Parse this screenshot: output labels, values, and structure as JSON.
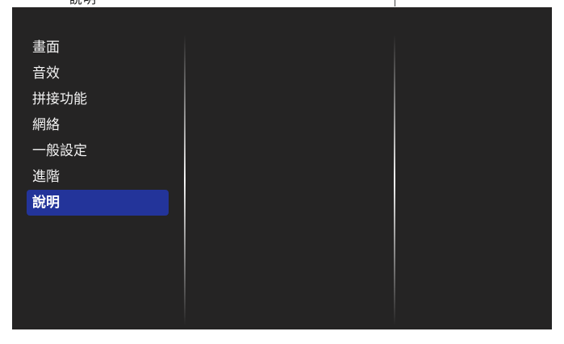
{
  "top_fragment": "說明",
  "menu": {
    "items": [
      {
        "label": "畫面"
      },
      {
        "label": "音效"
      },
      {
        "label": "拼接功能"
      },
      {
        "label": "網絡"
      },
      {
        "label": "一般設定"
      },
      {
        "label": "進階"
      },
      {
        "label": "說明"
      }
    ],
    "selected_index": 6
  },
  "colors": {
    "panel_background": "#252424",
    "selected_highlight": "#23349a",
    "menu_text": "#f2f2f2",
    "page_background": "#ffffff"
  }
}
